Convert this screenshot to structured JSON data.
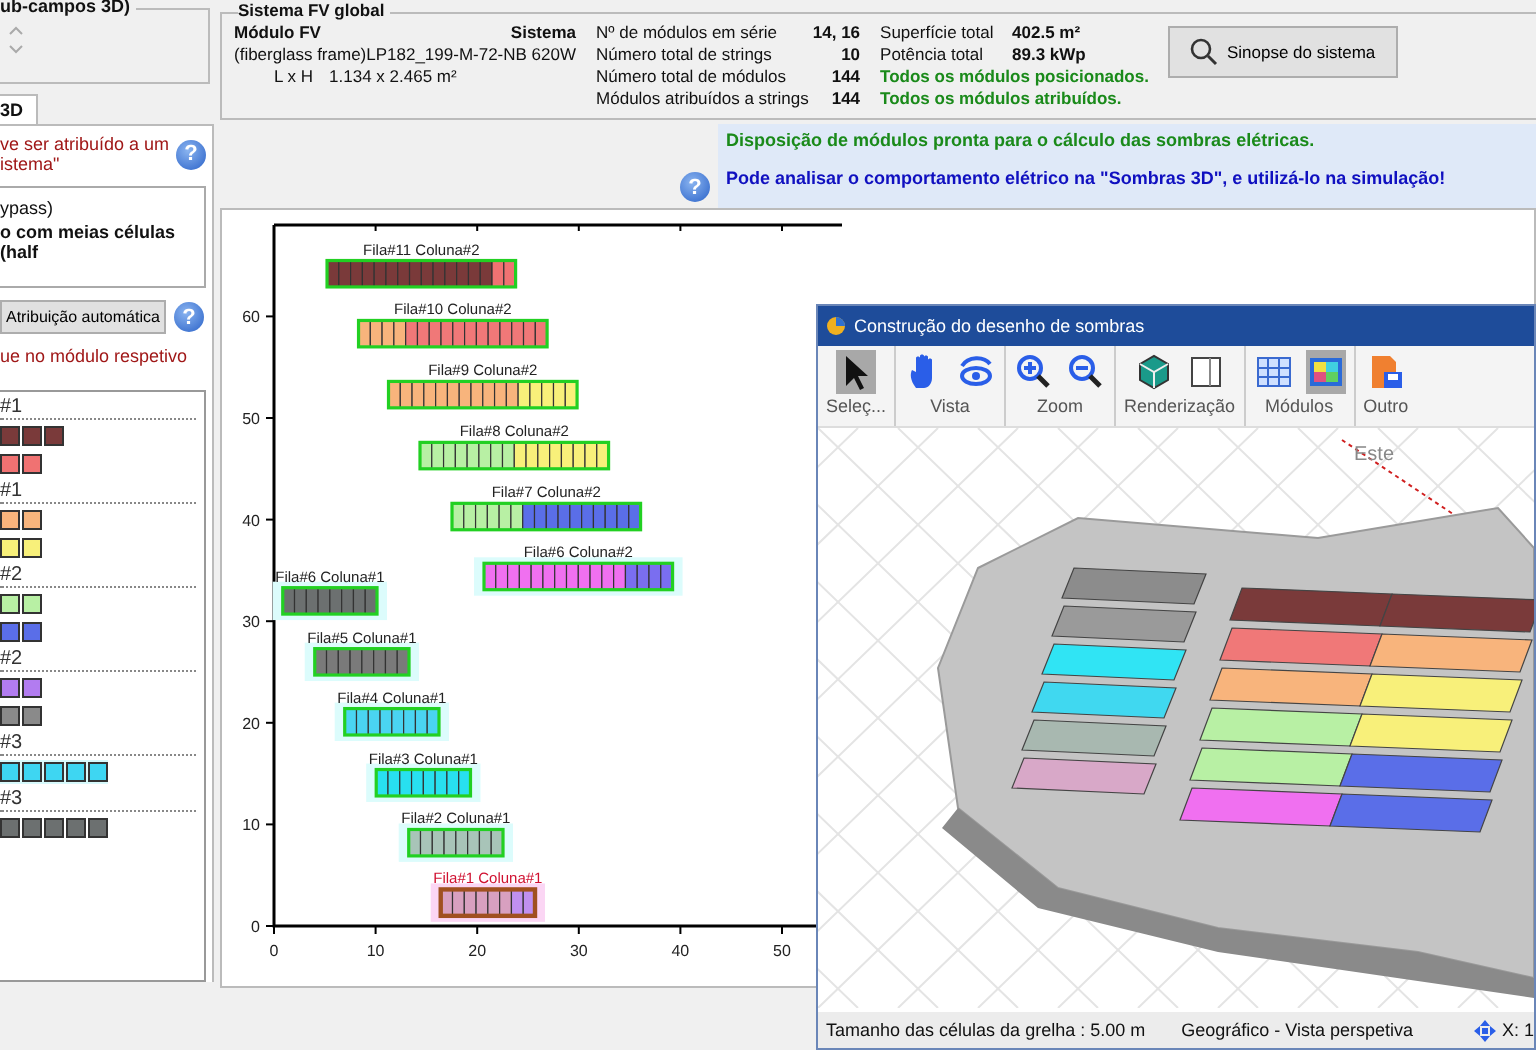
{
  "subfields_box": {
    "title": "ub-campos 3D)"
  },
  "left_tab": {
    "label": "3D",
    "selected": true
  },
  "left_panel": {
    "notice": [
      "ve ser atribuído a um",
      "istema\""
    ],
    "help": "?",
    "options": [
      "ypass)",
      "o com meias células (half"
    ],
    "auto_button": "Atribuição automática",
    "help_2": "?",
    "hint": "ue no módulo respetivo",
    "groups": [
      {
        "label": "#1",
        "rows": [
          {
            "highlighted": false,
            "squares": [
              {
                "color": "#7a3a3a"
              },
              {
                "color": "#7a3a3a"
              },
              {
                "color": "#7a3a3a"
              }
            ]
          },
          {
            "highlighted": false,
            "squares": [
              {
                "color": "#f07272"
              },
              {
                "color": "#f07272"
              }
            ]
          }
        ]
      },
      {
        "label": "#1",
        "rows": [
          {
            "highlighted": false,
            "squares": [
              {
                "color": "#f8b47c"
              },
              {
                "color": "#f8b47c"
              }
            ]
          },
          {
            "highlighted": false,
            "squares": [
              {
                "color": "#f8f07a"
              },
              {
                "color": "#f8f07a"
              }
            ]
          }
        ]
      },
      {
        "label": "#2",
        "rows": [
          {
            "highlighted": false,
            "squares": [
              {
                "color": "#b8f0a4"
              },
              {
                "color": "#b8f0a4"
              }
            ]
          },
          {
            "highlighted": false,
            "squares": [
              {
                "color": "#5a6ee8"
              },
              {
                "color": "#5a6ee8"
              }
            ]
          }
        ]
      },
      {
        "label": "#2",
        "rows": [
          {
            "highlighted": false,
            "squares": [
              {
                "color": "#b27cf0"
              },
              {
                "color": "#b27cf0"
              }
            ]
          },
          {
            "highlighted": false,
            "squares": [
              {
                "color": "#8a8a8a"
              },
              {
                "color": "#8a8a8a"
              }
            ]
          }
        ]
      },
      {
        "label": "#3",
        "rows": [
          {
            "highlighted": true,
            "squares": [
              {
                "color": "#3ed6f2"
              },
              {
                "color": "#3ed6f2"
              },
              {
                "color": "#3ed6f2"
              },
              {
                "color": "#3ed6f2"
              },
              {
                "color": "#3ed6f2"
              }
            ]
          }
        ]
      },
      {
        "label": "#3",
        "rows": [
          {
            "highlighted": false,
            "squares": [
              {
                "color": "#6c7070"
              },
              {
                "color": "#6c7070"
              },
              {
                "color": "#6c7070"
              },
              {
                "color": "#6c7070"
              },
              {
                "color": "#6c7070"
              }
            ]
          }
        ]
      }
    ]
  },
  "global_system": {
    "title": "Sistema FV global",
    "module_heading": "Módulo FV",
    "module_name": "(fiberglass frame)LP182_199-M-72-NB 620W",
    "dims_label": "L x H",
    "dims_value": "1.134 x 2.465 m²",
    "system_heading": "Sistema",
    "stats": [
      {
        "label": "Nº de módulos em série",
        "value": "14, 16"
      },
      {
        "label": "Número total de strings",
        "value": "10"
      },
      {
        "label": "Número total de módulos",
        "value": "144"
      },
      {
        "label": "Módulos atribuídos a strings",
        "value": "144"
      }
    ],
    "totals": [
      {
        "label": "Superfície total",
        "value": "402.5 m²"
      },
      {
        "label": "Potência total",
        "value": "89.3 kWp"
      }
    ],
    "status": [
      "Todos os módulos posicionados.",
      "Todos os módulos atribuídos."
    ],
    "synopsis_button": "Sinopse do sistema"
  },
  "messages": {
    "help": "?",
    "ready": "Disposição de módulos pronta para o cálculo das sombras elétricas.",
    "hint": "Pode analisar o comportamento elétrico na \"Sombras 3D\", e utilizá-lo na simulação!"
  },
  "layout_plot": {
    "x_ticks": [
      "0",
      "10",
      "20",
      "30",
      "40",
      "50"
    ],
    "y_ticks": [
      "60",
      "50",
      "40",
      "30",
      "20",
      "10",
      "0"
    ],
    "rows": [
      {
        "label": "Fila#11 Coluna#2",
        "selected": false,
        "highlighted": false,
        "cells": [
          {
            "color": "#7a3a3a"
          },
          {
            "color": "#7a3a3a"
          },
          {
            "color": "#7a3a3a"
          },
          {
            "color": "#7a3a3a"
          },
          {
            "color": "#7a3a3a"
          },
          {
            "color": "#7a3a3a"
          },
          {
            "color": "#7a3a3a"
          },
          {
            "color": "#7a3a3a"
          },
          {
            "color": "#7a3a3a"
          },
          {
            "color": "#7a3a3a"
          },
          {
            "color": "#7a3a3a"
          },
          {
            "color": "#7a3a3a"
          },
          {
            "color": "#7a3a3a"
          },
          {
            "color": "#7a3a3a"
          },
          {
            "color": "#f07272"
          },
          {
            "color": "#f07272"
          }
        ]
      },
      {
        "label": "Fila#10 Coluna#2",
        "selected": false,
        "highlighted": false,
        "cells": [
          {
            "color": "#f8b47c"
          },
          {
            "color": "#f8b47c"
          },
          {
            "color": "#f8b47c"
          },
          {
            "color": "#f8b47c"
          },
          {
            "color": "#f07878"
          },
          {
            "color": "#f07878"
          },
          {
            "color": "#f07878"
          },
          {
            "color": "#f07878"
          },
          {
            "color": "#f07878"
          },
          {
            "color": "#f07878"
          },
          {
            "color": "#f07878"
          },
          {
            "color": "#f07878"
          },
          {
            "color": "#f07878"
          },
          {
            "color": "#f07878"
          },
          {
            "color": "#f07878"
          },
          {
            "color": "#f07878"
          }
        ]
      },
      {
        "label": "Fila#9 Coluna#2",
        "selected": false,
        "highlighted": false,
        "cells": [
          {
            "color": "#f8b47c"
          },
          {
            "color": "#f8b47c"
          },
          {
            "color": "#f8b47c"
          },
          {
            "color": "#f8b47c"
          },
          {
            "color": "#f8b47c"
          },
          {
            "color": "#f8b47c"
          },
          {
            "color": "#f8b47c"
          },
          {
            "color": "#f8b47c"
          },
          {
            "color": "#f8b47c"
          },
          {
            "color": "#f8b47c"
          },
          {
            "color": "#f8b47c"
          },
          {
            "color": "#f8f07a"
          },
          {
            "color": "#f8f07a"
          },
          {
            "color": "#f8f07a"
          },
          {
            "color": "#f8f07a"
          },
          {
            "color": "#f8f07a"
          }
        ]
      },
      {
        "label": "Fila#8 Coluna#2",
        "selected": false,
        "highlighted": false,
        "cells": [
          {
            "color": "#b8f0a4"
          },
          {
            "color": "#b8f0a4"
          },
          {
            "color": "#b8f0a4"
          },
          {
            "color": "#b8f0a4"
          },
          {
            "color": "#b8f0a4"
          },
          {
            "color": "#b8f0a4"
          },
          {
            "color": "#b8f0a4"
          },
          {
            "color": "#b8f0a4"
          },
          {
            "color": "#f8f07a"
          },
          {
            "color": "#f8f07a"
          },
          {
            "color": "#f8f07a"
          },
          {
            "color": "#f8f07a"
          },
          {
            "color": "#f8f07a"
          },
          {
            "color": "#f8f07a"
          },
          {
            "color": "#f8f07a"
          },
          {
            "color": "#f8f07a"
          }
        ]
      },
      {
        "label": "Fila#7 Coluna#2",
        "selected": false,
        "highlighted": false,
        "cells": [
          {
            "color": "#b8f0a4"
          },
          {
            "color": "#b8f0a4"
          },
          {
            "color": "#b8f0a4"
          },
          {
            "color": "#b8f0a4"
          },
          {
            "color": "#b8f0a4"
          },
          {
            "color": "#b8f0a4"
          },
          {
            "color": "#5a6ee8"
          },
          {
            "color": "#5a6ee8"
          },
          {
            "color": "#5a6ee8"
          },
          {
            "color": "#5a6ee8"
          },
          {
            "color": "#5a6ee8"
          },
          {
            "color": "#5a6ee8"
          },
          {
            "color": "#5a6ee8"
          },
          {
            "color": "#5a6ee8"
          },
          {
            "color": "#5a6ee8"
          },
          {
            "color": "#5a6ee8"
          }
        ]
      },
      {
        "label": "Fila#6 Coluna#2",
        "selected": false,
        "highlighted": true,
        "cells": [
          {
            "color": "#f070f0"
          },
          {
            "color": "#f070f0"
          },
          {
            "color": "#f070f0"
          },
          {
            "color": "#f070f0"
          },
          {
            "color": "#f070f0"
          },
          {
            "color": "#f070f0"
          },
          {
            "color": "#f070f0"
          },
          {
            "color": "#f070f0"
          },
          {
            "color": "#f070f0"
          },
          {
            "color": "#f070f0"
          },
          {
            "color": "#f070f0"
          },
          {
            "color": "#f070f0"
          },
          {
            "color": "#7a6ef0"
          },
          {
            "color": "#7a6ef0"
          },
          {
            "color": "#7a6ef0"
          },
          {
            "color": "#7a6ef0"
          }
        ]
      },
      {
        "label": "Fila#6 Coluna#1",
        "selected": false,
        "highlighted": true,
        "cells": [
          {
            "color": "#6c7070"
          },
          {
            "color": "#6c7070"
          },
          {
            "color": "#6c7070"
          },
          {
            "color": "#6c7070"
          },
          {
            "color": "#6c7070"
          },
          {
            "color": "#6c7070"
          },
          {
            "color": "#6c7070"
          },
          {
            "color": "#6c7070"
          }
        ]
      },
      {
        "label": "Fila#5 Coluna#1",
        "selected": false,
        "highlighted": true,
        "cells": [
          {
            "color": "#7a7a7a"
          },
          {
            "color": "#7a7a7a"
          },
          {
            "color": "#7a7a7a"
          },
          {
            "color": "#7a7a7a"
          },
          {
            "color": "#7a7a7a"
          },
          {
            "color": "#7a7a7a"
          },
          {
            "color": "#7a7a7a"
          },
          {
            "color": "#7a7a7a"
          }
        ]
      },
      {
        "label": "Fila#4 Coluna#1",
        "selected": false,
        "highlighted": true,
        "cells": [
          {
            "color": "#4ad4f2"
          },
          {
            "color": "#4ad4f2"
          },
          {
            "color": "#4ad4f2"
          },
          {
            "color": "#4ad4f2"
          },
          {
            "color": "#4ad4f2"
          },
          {
            "color": "#4ad4f2"
          },
          {
            "color": "#4ad4f2"
          },
          {
            "color": "#4ad4f2"
          }
        ]
      },
      {
        "label": "Fila#3 Coluna#1",
        "selected": false,
        "highlighted": true,
        "cells": [
          {
            "color": "#28e0f0"
          },
          {
            "color": "#28e0f0"
          },
          {
            "color": "#28e0f0"
          },
          {
            "color": "#28e0f0"
          },
          {
            "color": "#28e0f0"
          },
          {
            "color": "#28e0f0"
          },
          {
            "color": "#28e0f0"
          },
          {
            "color": "#28e0f0"
          }
        ]
      },
      {
        "label": "Fila#2 Coluna#1",
        "selected": false,
        "highlighted": true,
        "cells": [
          {
            "color": "#a8c4b8"
          },
          {
            "color": "#a8c4b8"
          },
          {
            "color": "#a8c4b8"
          },
          {
            "color": "#a8c4b8"
          },
          {
            "color": "#a8c4b8"
          },
          {
            "color": "#a8c4b8"
          },
          {
            "color": "#a8c4b8"
          },
          {
            "color": "#a8c4b8"
          }
        ]
      },
      {
        "label": "Fila#1 Coluna#1",
        "selected": true,
        "highlighted": true,
        "cells": [
          {
            "color": "#d8a0c0"
          },
          {
            "color": "#d8a0c0"
          },
          {
            "color": "#d8a0c0"
          },
          {
            "color": "#d8a0c0"
          },
          {
            "color": "#d8a0c0"
          },
          {
            "color": "#d8a0c0"
          },
          {
            "color": "#c090f0"
          },
          {
            "color": "#c090f0"
          }
        ]
      }
    ]
  },
  "shadow_window": {
    "title": "Construção do desenho de sombras",
    "tool_groups": [
      {
        "label": "Seleç...",
        "tools": [
          {
            "kind": "select",
            "selected": true
          }
        ]
      },
      {
        "label": "Vista",
        "tools": [
          {
            "kind": "pan",
            "selected": false
          },
          {
            "kind": "orbit",
            "selected": false
          }
        ]
      },
      {
        "label": "Zoom",
        "tools": [
          {
            "kind": "zoom-in",
            "selected": false
          },
          {
            "kind": "zoom-out",
            "selected": false
          }
        ]
      },
      {
        "label": "Renderização",
        "tools": [
          {
            "kind": "shaded",
            "selected": false
          },
          {
            "kind": "wireframe",
            "selected": false
          }
        ]
      },
      {
        "label": "Módulos",
        "tools": [
          {
            "kind": "grid",
            "selected": false
          },
          {
            "kind": "colored",
            "selected": true
          }
        ]
      },
      {
        "label": "Outro",
        "tools": [
          {
            "kind": "export",
            "selected": false
          }
        ]
      }
    ],
    "compass_label": "Este",
    "status": {
      "grid_size": "Tamanho das células da grelha :  5.00 m",
      "view": "Geográfico - Vista perspetiva",
      "coords": "X: 1"
    }
  }
}
